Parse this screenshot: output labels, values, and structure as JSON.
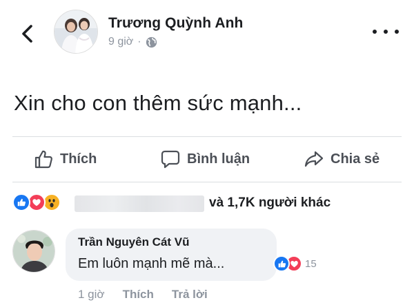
{
  "post": {
    "author_name": "Trương Quỳnh Anh",
    "time": "9 giờ",
    "separator": "·",
    "text": "Xin cho con thêm sức mạnh..."
  },
  "icons": {
    "back": "chevron-left-icon",
    "more": "more-horizontal-icon",
    "globe": "globe-icon",
    "like": "thumbs-up-icon",
    "comment": "comment-bubble-icon",
    "share": "share-arrow-icon"
  },
  "actions": {
    "like": "Thích",
    "comment": "Bình luận",
    "share": "Chia sẻ"
  },
  "reactions": {
    "types": [
      "like",
      "love",
      "wow"
    ],
    "others_text": "và 1,7K người khác"
  },
  "comment": {
    "author_name": "Trần Nguyên Cát Vũ",
    "text": "Em luôn mạnh mẽ mà...",
    "reaction_types": [
      "like",
      "love"
    ],
    "reaction_count": "15",
    "time": "1 giờ",
    "like": "Thích",
    "reply": "Trả lời"
  },
  "colors": {
    "like_blue": "#1877f2",
    "love_red": "#f33e58",
    "wow_yellow": "#f7b125",
    "text_primary": "#1c1e21",
    "text_secondary": "#8d949e",
    "action_gray": "#4b4f56",
    "bubble_bg": "#f0f2f5"
  }
}
